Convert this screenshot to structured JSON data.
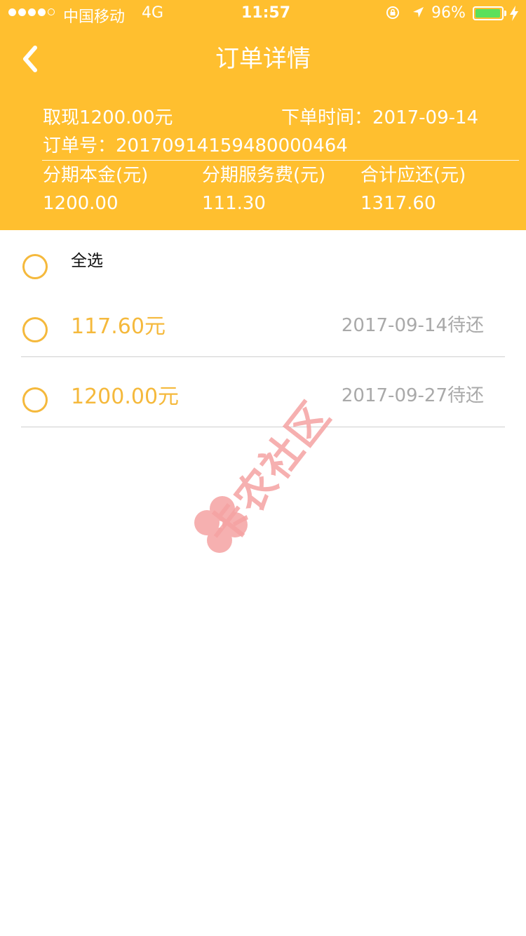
{
  "status_bar": {
    "carrier": "中国移动",
    "network": "4G",
    "time": "11:57",
    "battery": "96%",
    "battery_level": 0.96
  },
  "nav": {
    "title": "订单详情"
  },
  "order": {
    "withdraw": "取现1200.00元",
    "order_time": "下单时间：2017-09-14",
    "order_no": "订单号：20170914159480000464"
  },
  "summary": {
    "principal_label": "分期本金(元)",
    "principal_value": "1200.00",
    "fee_label": "分期服务费(元)",
    "fee_value": "111.30",
    "total_label": "合计应还(元)",
    "total_value": "1317.60"
  },
  "select_all_label": "全选",
  "installments": [
    {
      "amount": "117.60元",
      "due": "2017-09-14待还"
    },
    {
      "amount": "1200.00元",
      "due": "2017-09-27待还"
    }
  ],
  "watermark": "卡农社区",
  "colors": {
    "accent": "#FFBF2F",
    "amount": "#F5B93C",
    "muted": "#A9A9A9",
    "watermark": "#F5A3A3"
  }
}
